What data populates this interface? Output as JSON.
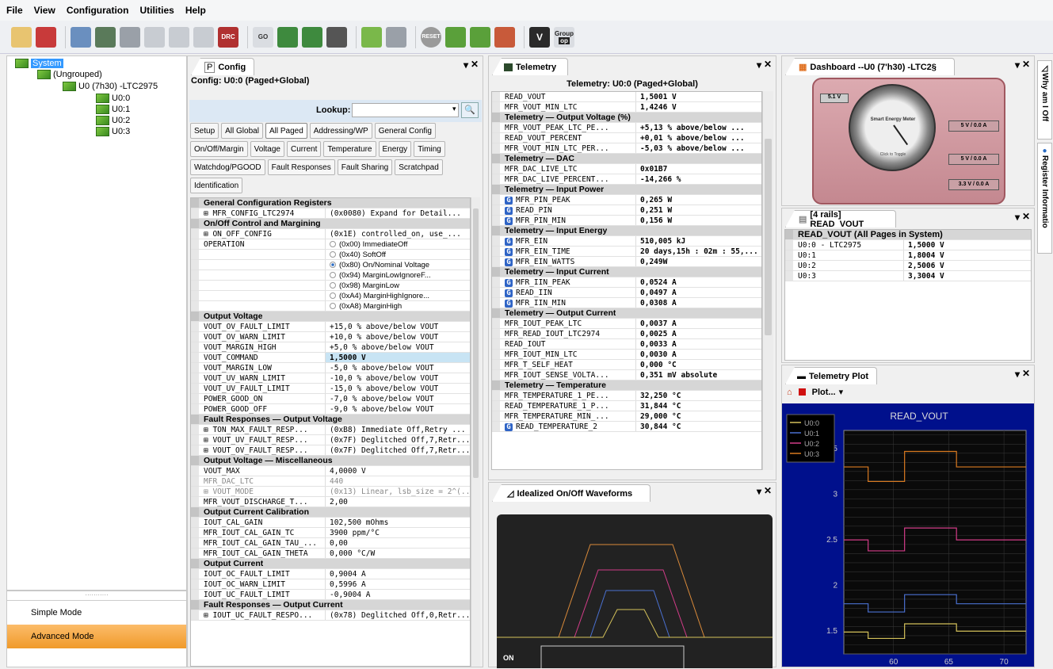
{
  "menu": [
    "File",
    "View",
    "Configuration",
    "Utilities",
    "Help"
  ],
  "toolbar": {
    "drc": "DRC",
    "reset": "RESET",
    "group_line1": "Group",
    "group_line2": "op",
    "v": "V",
    "go": "GO"
  },
  "tree": {
    "root": "System",
    "ungrouped": "(Ungrouped)",
    "device": "U0 (7h30) -LTC2975",
    "pages": [
      "U0:0",
      "U0:1",
      "U0:2",
      "U0:3"
    ]
  },
  "modes": {
    "simple": "Simple Mode",
    "advanced": "Advanced Mode"
  },
  "config": {
    "tab_label": "Config",
    "title": "Config: U0:0 (Paged+Global)",
    "lookup_label": "Lookup:",
    "lookup_value": "",
    "tab_rows": [
      [
        "Setup",
        "All Global",
        "All Paged",
        "Addressing/WP",
        "General Config"
      ],
      [
        "On/Off/Margin",
        "Voltage",
        "Current",
        "Temperature",
        "Energy",
        "Timing"
      ],
      [
        "Watchdog/PGOOD",
        "Fault Responses",
        "Fault Sharing",
        "Scratchpad"
      ],
      [
        "Identification"
      ]
    ],
    "selected_tab": "All Paged",
    "rows": [
      {
        "h": "General Configuration Registers"
      },
      {
        "n": "⊞ MFR_CONFIG_LTC2974",
        "v": "(0x0080) Expand for Detail..."
      },
      {
        "h": "On/Off Control and Margining"
      },
      {
        "n": "⊞ ON_OFF_CONFIG",
        "v": "(0x1E)  controlled_on, use_..."
      },
      {
        "n": "OPERATION",
        "r": "(0x00) ImmediateOff"
      },
      {
        "n": "",
        "r": "(0x40) SoftOff"
      },
      {
        "n": "",
        "r": "(0x80) On/Nominal Voltage",
        "on": true
      },
      {
        "n": "",
        "r": "(0x94) MarginLowIgnoreF..."
      },
      {
        "n": "",
        "r": "(0x98) MarginLow"
      },
      {
        "n": "",
        "r": "(0xA4) MarginHighIgnore..."
      },
      {
        "n": "",
        "r": "(0xA8) MarginHigh"
      },
      {
        "h": "Output Voltage"
      },
      {
        "n": "VOUT_OV_FAULT_LIMIT",
        "v": "+15,0 % above/below VOUT"
      },
      {
        "n": "VOUT_OV_WARN_LIMIT",
        "v": "+10,0 % above/below VOUT"
      },
      {
        "n": "VOUT_MARGIN_HIGH",
        "v": "+5,0 % above/below VOUT"
      },
      {
        "n": "VOUT_COMMAND",
        "v": "1,5000 V",
        "b": true,
        "sel": true
      },
      {
        "n": "VOUT_MARGIN_LOW",
        "v": "-5,0 % above/below VOUT"
      },
      {
        "n": "VOUT_UV_WARN_LIMIT",
        "v": "-10,0 % above/below VOUT"
      },
      {
        "n": "VOUT_UV_FAULT_LIMIT",
        "v": "-15,0 % above/below VOUT"
      },
      {
        "n": "POWER_GOOD_ON",
        "v": "-7,0 % above/below VOUT"
      },
      {
        "n": "POWER_GOOD_OFF",
        "v": "-9,0 % above/below VOUT"
      },
      {
        "h": "Fault Responses — Output Voltage"
      },
      {
        "n": "⊞ TON_MAX_FAULT_RESP...",
        "v": "(0xB8) Immediate Off,Retry ..."
      },
      {
        "n": "⊞ VOUT_UV_FAULT_RESP...",
        "v": "(0x7F) Deglitched Off,7,Retr..."
      },
      {
        "n": "⊞ VOUT_OV_FAULT_RESP...",
        "v": "(0x7F) Deglitched Off,7,Retr..."
      },
      {
        "h": "Output Voltage — Miscellaneous"
      },
      {
        "n": "VOUT_MAX",
        "v": "4,0000 V"
      },
      {
        "n": "MFR_DAC_LTC",
        "v": "440",
        "g": true
      },
      {
        "n": "⊞ VOUT_MODE",
        "v": "(0x13) Linear, lsb_size = 2^(...",
        "g": true
      },
      {
        "n": "MFR_VOUT_DISCHARGE_T...",
        "v": "2,00"
      },
      {
        "h": "Output Current Calibration"
      },
      {
        "n": "IOUT_CAL_GAIN",
        "v": "102,500 mOhms"
      },
      {
        "n": "MFR_IOUT_CAL_GAIN_TC",
        "v": "3900 ppm/°C"
      },
      {
        "n": "MFR_IOUT_CAL_GAIN_TAU_...",
        "v": "0,00"
      },
      {
        "n": "MFR_IOUT_CAL_GAIN_THETA",
        "v": "0,000 °C/W"
      },
      {
        "h": "Output Current"
      },
      {
        "n": "IOUT_OC_FAULT_LIMIT",
        "v": "0,9004 A"
      },
      {
        "n": "IOUT_OC_WARN_LIMIT",
        "v": "0,5996 A"
      },
      {
        "n": "IOUT_UC_FAULT_LIMIT",
        "v": "-0,9004 A"
      },
      {
        "h": "Fault Responses — Output Current"
      },
      {
        "n": "⊞ IOUT_UC_FAULT_RESPO...",
        "v": "(0x78) Deglitched Off,0,Retr..."
      }
    ]
  },
  "telemetry": {
    "tab_label": "Telemetry",
    "title": "Telemetry: U0:0 (Paged+Global)",
    "rows": [
      {
        "n": "READ_VOUT",
        "v": "1,5001 V"
      },
      {
        "n": "MFR_VOUT_MIN_LTC",
        "v": "1,4246 V"
      },
      {
        "h": "Telemetry — Output Voltage (%)"
      },
      {
        "n": "MFR_VOUT_PEAK_LTC_PE...",
        "v": "+5,13 % above/below ..."
      },
      {
        "n": "READ_VOUT_PERCENT",
        "v": "+0,01 % above/below ..."
      },
      {
        "n": "MFR_VOUT_MIN_LTC_PER...",
        "v": "-5,03 % above/below ..."
      },
      {
        "h": "Telemetry — DAC"
      },
      {
        "n": "MFR_DAC_LIVE_LTC",
        "v": "0x01B7"
      },
      {
        "n": "MFR_DAC_LIVE_PERCENT...",
        "v": "-14,266 %"
      },
      {
        "h": "Telemetry — Input Power"
      },
      {
        "n": "MFR_PIN_PEAK",
        "v": "0,265 W",
        "g": true
      },
      {
        "n": "READ_PIN",
        "v": "0,251 W",
        "g": true
      },
      {
        "n": "MFR_PIN_MIN",
        "v": "0,156 W",
        "g": true
      },
      {
        "h": "Telemetry — Input Energy"
      },
      {
        "n": "MFR_EIN",
        "v": "510,005 kJ",
        "g": true
      },
      {
        "n": "MFR_EIN_TIME",
        "v": "20 days,15h : 02m : 55,...",
        "g": true
      },
      {
        "n": "MFR_EIN_WATTS",
        "v": "0,249W",
        "g": true
      },
      {
        "h": "Telemetry — Input Current"
      },
      {
        "n": "MFR_IIN_PEAK",
        "v": "0,0524 A",
        "g": true
      },
      {
        "n": "READ_IIN",
        "v": "0,0497 A",
        "g": true
      },
      {
        "n": "MFR_IIN_MIN",
        "v": "0,0308 A",
        "g": true
      },
      {
        "h": "Telemetry — Output Current"
      },
      {
        "n": "MFR_IOUT_PEAK_LTC",
        "v": "0,0037 A"
      },
      {
        "n": "MFR_READ_IOUT_LTC2974",
        "v": "0,0025 A"
      },
      {
        "n": "READ_IOUT",
        "v": "0,0033 A"
      },
      {
        "n": "MFR_IOUT_MIN_LTC",
        "v": "0,0030 A"
      },
      {
        "n": "MFR_T_SELF_HEAT",
        "v": "0,000 °C"
      },
      {
        "n": "MFR_IOUT_SENSE_VOLTA...",
        "v": "0,351 mV absolute"
      },
      {
        "h": "Telemetry — Temperature"
      },
      {
        "n": "MFR_TEMPERATURE_1_PE...",
        "v": "32,250 °C"
      },
      {
        "n": "READ_TEMPERATURE_1_P...",
        "v": "31,844 °C"
      },
      {
        "n": "MFR_TEMPERATURE_MIN_...",
        "v": "29,000 °C"
      },
      {
        "n": "READ_TEMPERATURE_2",
        "v": "30,844 °C",
        "g": true
      }
    ]
  },
  "waves": {
    "tab_label": "Idealized On/Off Waveforms",
    "on_label": "ON"
  },
  "dash": {
    "tab_label": "Dashboard --U0 (7'h30) -LTC2§",
    "rails": [
      "5 V / 0.0 A",
      "5 V / 0.0 A",
      "3.3 V / 0.0 A"
    ],
    "left_rail": "5.1 V",
    "meter_title": "Smart Energy Meter",
    "meter_caption": "Click to Toggle"
  },
  "rails": {
    "tab_label": "[4 rails] READ_VOUT",
    "header": "READ_VOUT (All Pages in System)",
    "rows": [
      [
        "U0:0 - LTC2975",
        "1,5000 V"
      ],
      [
        "U0:1",
        "1,8004 V"
      ],
      [
        "U0:2",
        "2,5006 V"
      ],
      [
        "U0:3",
        "3,3004 V"
      ]
    ]
  },
  "tplot": {
    "tab_label": "Telemetry Plot",
    "plot_menu": "Plot...",
    "plot_title": "READ_VOUT"
  },
  "side_tabs": [
    "Why am I Off",
    "Register Informatio"
  ],
  "chart_data": {
    "type": "line",
    "title": "READ_VOUT",
    "x_ticks": [
      60,
      65,
      70
    ],
    "y_ticks": [
      1.5,
      2,
      2.5,
      3,
      3.5
    ],
    "xlim": [
      55.5,
      72
    ],
    "ylim": [
      1.25,
      3.7
    ],
    "series": [
      {
        "name": "U0:0",
        "color": "#d4c15a",
        "values": [
          [
            55.5,
            1.49
          ],
          [
            57.7,
            1.49
          ],
          [
            57.7,
            1.42
          ],
          [
            61,
            1.42
          ],
          [
            61,
            1.58
          ],
          [
            65.7,
            1.58
          ],
          [
            65.7,
            1.5
          ],
          [
            72,
            1.5
          ]
        ]
      },
      {
        "name": "U0:1",
        "color": "#4a70d0",
        "values": [
          [
            55.5,
            1.8
          ],
          [
            57.7,
            1.8
          ],
          [
            57.7,
            1.71
          ],
          [
            61,
            1.71
          ],
          [
            61,
            1.9
          ],
          [
            65.7,
            1.9
          ],
          [
            65.7,
            1.8
          ],
          [
            72,
            1.8
          ]
        ]
      },
      {
        "name": "U0:2",
        "color": "#d23c88",
        "values": [
          [
            55.5,
            2.5
          ],
          [
            57.7,
            2.5
          ],
          [
            57.7,
            2.38
          ],
          [
            61,
            2.38
          ],
          [
            61,
            2.63
          ],
          [
            65.7,
            2.63
          ],
          [
            65.7,
            2.5
          ],
          [
            72,
            2.5
          ]
        ]
      },
      {
        "name": "U0:3",
        "color": "#d97a20",
        "values": [
          [
            55.5,
            3.3
          ],
          [
            57.7,
            3.3
          ],
          [
            57.7,
            3.14
          ],
          [
            61,
            3.14
          ],
          [
            61,
            3.47
          ],
          [
            65.7,
            3.47
          ],
          [
            65.7,
            3.3
          ],
          [
            72,
            3.3
          ]
        ]
      }
    ]
  }
}
